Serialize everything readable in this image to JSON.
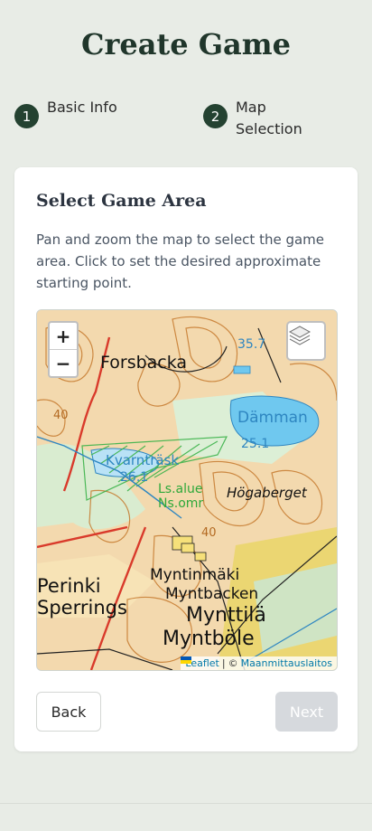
{
  "page": {
    "title": "Create Game"
  },
  "steps": [
    {
      "number": "1",
      "label": "Basic Info"
    },
    {
      "number": "2",
      "label": "Map Selection"
    }
  ],
  "card": {
    "heading": "Select Game Area",
    "description": "Pan and zoom the map to select the game area. Click to set the desired approximate starting point."
  },
  "map": {
    "zoom_in": "+",
    "zoom_out": "−",
    "layers_icon": "layers-icon",
    "place_labels": {
      "forsbacka": "Forsbacka",
      "damman": "Dämman",
      "damman_elev": "25.1",
      "kvarntrask": "Kvarnträsk",
      "kvarntrask_elev": "26.1",
      "ls_alue": "Ls.alue",
      "ns_omr": "Ns.omr",
      "hogaberget": "Högaberget",
      "perinki": "Perinki",
      "sperrings": "Sperrings",
      "myntinmaki": "Myntinmäki",
      "myntbacken": "Myntbacken",
      "mynttila": "Mynttilä",
      "myntbole": "Myntböle",
      "elev_357": "35.7",
      "contour_40a": "40",
      "contour_40b": "40"
    },
    "attribution": {
      "leaflet": "Leaflet",
      "separator": "|",
      "copyright": "©",
      "provider": "Maanmittauslaitos"
    },
    "colors": {
      "terrain": "#f3d9ae",
      "water": "#6fc8ef",
      "contour": "#c67a2e",
      "road": "#d93a2b",
      "protected": "#3cb34a"
    }
  },
  "buttons": {
    "back": "Back",
    "next": "Next"
  }
}
